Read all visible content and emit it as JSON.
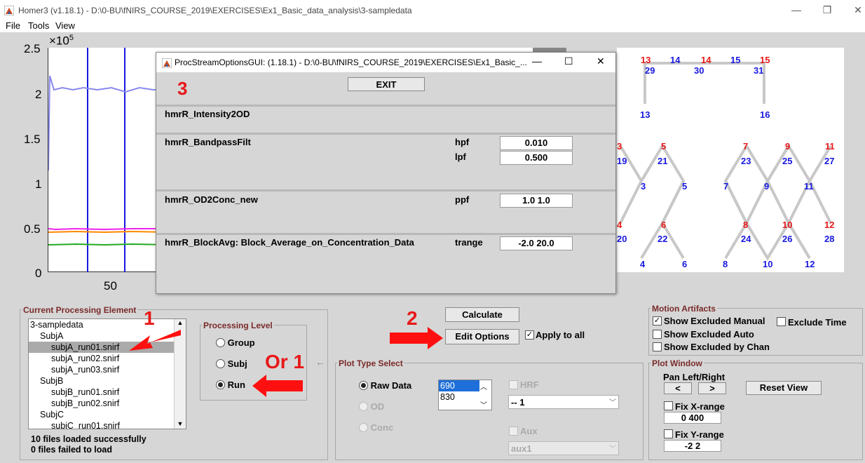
{
  "window": {
    "title": "Homer3 (v1.18.1) - D:\\0-BU\\fNIRS_COURSE_2019\\EXERCISES\\Ex1_Basic_data_analysis\\3-sampledata"
  },
  "menu": [
    "File",
    "Tools",
    "View"
  ],
  "plot": {
    "yticks": [
      "2.5",
      "2",
      "1.5",
      "1",
      "0.5",
      "0"
    ],
    "exponent": "×10",
    "exponent_power": "5",
    "xtick": "50"
  },
  "probe": {
    "top_row": [
      "13",
      "14",
      "14",
      "15",
      "15"
    ],
    "top_row_colors": [
      "#e81818",
      "#1818e0",
      "#e81818",
      "#1818e0",
      "#e81818"
    ],
    "blue_labels": [
      "29",
      "30",
      "31",
      "13",
      "16",
      "19",
      "21",
      "23",
      "25",
      "27",
      "3",
      "5",
      "7",
      "9",
      "11",
      "20",
      "22",
      "24",
      "26",
      "28",
      "4",
      "6",
      "8",
      "10",
      "12"
    ],
    "red_labels": [
      "3",
      "5",
      "7",
      "9",
      "11",
      "4",
      "6",
      "8",
      "10",
      "12"
    ]
  },
  "dialog": {
    "title": "ProcStreamOptionsGUI: (1.18.1) - D:\\0-BU\\fNIRS_COURSE_2019\\EXERCISES\\Ex1_Basic_...",
    "step_label": "3",
    "exit_label": "EXIT",
    "func1": "hmrR_Intensity2OD",
    "func2": "hmrR_BandpassFilt",
    "hpf_label": "hpf",
    "hpf_value": "0.010",
    "lpf_label": "lpf",
    "lpf_value": "0.500",
    "func3": "hmrR_OD2Conc_new",
    "ppf_label": "ppf",
    "ppf_value": "1.0 1.0",
    "func4": "hmrR_BlockAvg:  Block_Average_on_Concentration_Data",
    "trange_label": "trange",
    "trange_value": "-2.0 20.0"
  },
  "current_element": {
    "title": "Current Processing Element",
    "items": [
      "3-sampledata",
      "SubjA",
      "subjA_run01.snirf",
      "subjA_run02.snirf",
      "subjA_run03.snirf",
      "SubjB",
      "subjB_run01.snirf",
      "subjB_run02.snirf",
      "SubjC",
      "subjC_run01.snirf"
    ],
    "status1": "10 files loaded successfully",
    "status2": "0 files failed to load"
  },
  "processing_level": {
    "title": "Processing Level",
    "options": [
      "Group",
      "Subj",
      "Run"
    ],
    "selected": "Run"
  },
  "annotations": {
    "a1": "1",
    "a2": "2",
    "or1": "Or 1"
  },
  "actions": {
    "calculate": "Calculate",
    "edit_options": "Edit Options",
    "apply_to_all": "Apply to all"
  },
  "plot_type": {
    "title": "Plot Type Select",
    "options": [
      "Raw Data",
      "OD",
      "Conc"
    ],
    "wavelengths": [
      "690",
      "830"
    ],
    "hrf": "HRF",
    "cond_value": "-- 1",
    "aux": "Aux",
    "aux_value": "aux1"
  },
  "motion": {
    "title": "Motion Artifacts",
    "show_manual": "Show Excluded Manual",
    "exclude_time": "Exclude Time",
    "show_auto": "Show Excluded Auto",
    "show_chan": "Show Excluded by Chan"
  },
  "plot_window": {
    "title": "Plot Window",
    "pan": "Pan Left/Right",
    "left": "<",
    "right": ">",
    "reset": "Reset View",
    "fix_x": "Fix X-range",
    "x_value": "0 400",
    "fix_y": "Fix Y-range",
    "y_value": "-2 2"
  },
  "colors": {
    "accent_red": "#e81818",
    "probe_blue": "#1818e0",
    "panel_title": "#7a2a2a"
  }
}
